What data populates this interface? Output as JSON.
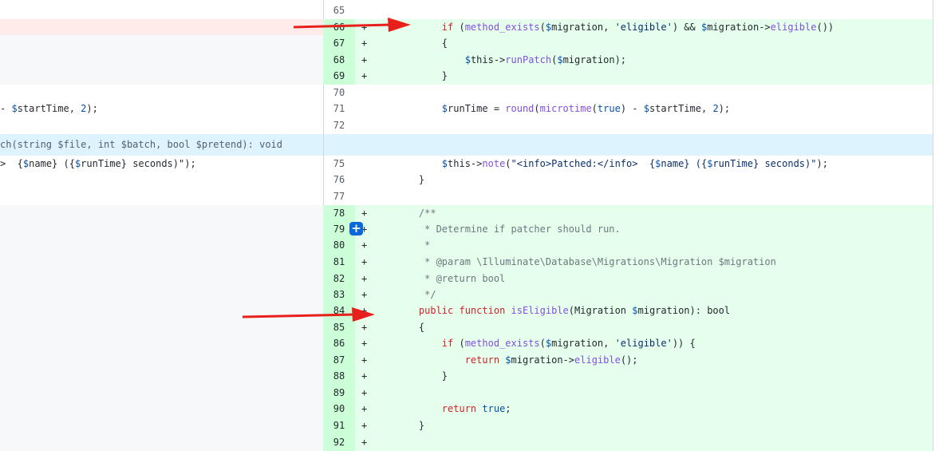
{
  "colors": {
    "addition_bg": "#e6ffec",
    "addition_num_bg": "#ccffd8",
    "deletion_bg": "#ffebe9",
    "hunk_bg": "#ddf4ff",
    "empty_bg": "#f6f8fa",
    "arrow": "#e8201c",
    "expand_button": "#0969da"
  },
  "left": {
    "line_a": "- $startTime, 2);",
    "hunk_header": "ch(string $file, int $batch, bool $pretend): void",
    "line_b": ">  {$name} ({$runTime} seconds)\");"
  },
  "right": {
    "lines": [
      {
        "num": "65",
        "sign": "",
        "text": ""
      },
      {
        "num": "66",
        "sign": "+",
        "text": "        if (method_exists($migration, 'eligible') && $migration->eligible())"
      },
      {
        "num": "67",
        "sign": "+",
        "text": "        {"
      },
      {
        "num": "68",
        "sign": "+",
        "text": "            $this->runPatch($migration);"
      },
      {
        "num": "69",
        "sign": "+",
        "text": "        }"
      },
      {
        "num": "70",
        "sign": "",
        "text": ""
      },
      {
        "num": "71",
        "sign": "",
        "text": "        $runTime = round(microtime(true) - $startTime, 2);"
      },
      {
        "num": "72",
        "sign": "",
        "text": ""
      },
      {
        "num": "75",
        "sign": "",
        "text": "        $this->note(\"<info>Patched:</info>  {$name} ({$runTime} seconds)\");"
      },
      {
        "num": "76",
        "sign": "",
        "text": "    }"
      },
      {
        "num": "77",
        "sign": "",
        "text": ""
      },
      {
        "num": "78",
        "sign": "+",
        "text": "    /**"
      },
      {
        "num": "79",
        "sign": "+",
        "text": "     * Determine if patcher should run."
      },
      {
        "num": "80",
        "sign": "+",
        "text": "     *"
      },
      {
        "num": "81",
        "sign": "+",
        "text": "     * @param \\Illuminate\\Database\\Migrations\\Migration $migration"
      },
      {
        "num": "82",
        "sign": "+",
        "text": "     * @return bool"
      },
      {
        "num": "83",
        "sign": "+",
        "text": "     */"
      },
      {
        "num": "84",
        "sign": "+",
        "text": "    public function isEligible(Migration $migration): bool"
      },
      {
        "num": "85",
        "sign": "+",
        "text": "    {"
      },
      {
        "num": "86",
        "sign": "+",
        "text": "        if (method_exists($migration, 'eligible')) {"
      },
      {
        "num": "87",
        "sign": "+",
        "text": "            return $migration->eligible();"
      },
      {
        "num": "88",
        "sign": "+",
        "text": "        }"
      },
      {
        "num": "89",
        "sign": "+",
        "text": ""
      },
      {
        "num": "90",
        "sign": "+",
        "text": "        return true;"
      },
      {
        "num": "91",
        "sign": "+",
        "text": "    }"
      },
      {
        "num": "92",
        "sign": "+",
        "text": ""
      }
    ]
  },
  "expand_button": {
    "label": "+"
  }
}
